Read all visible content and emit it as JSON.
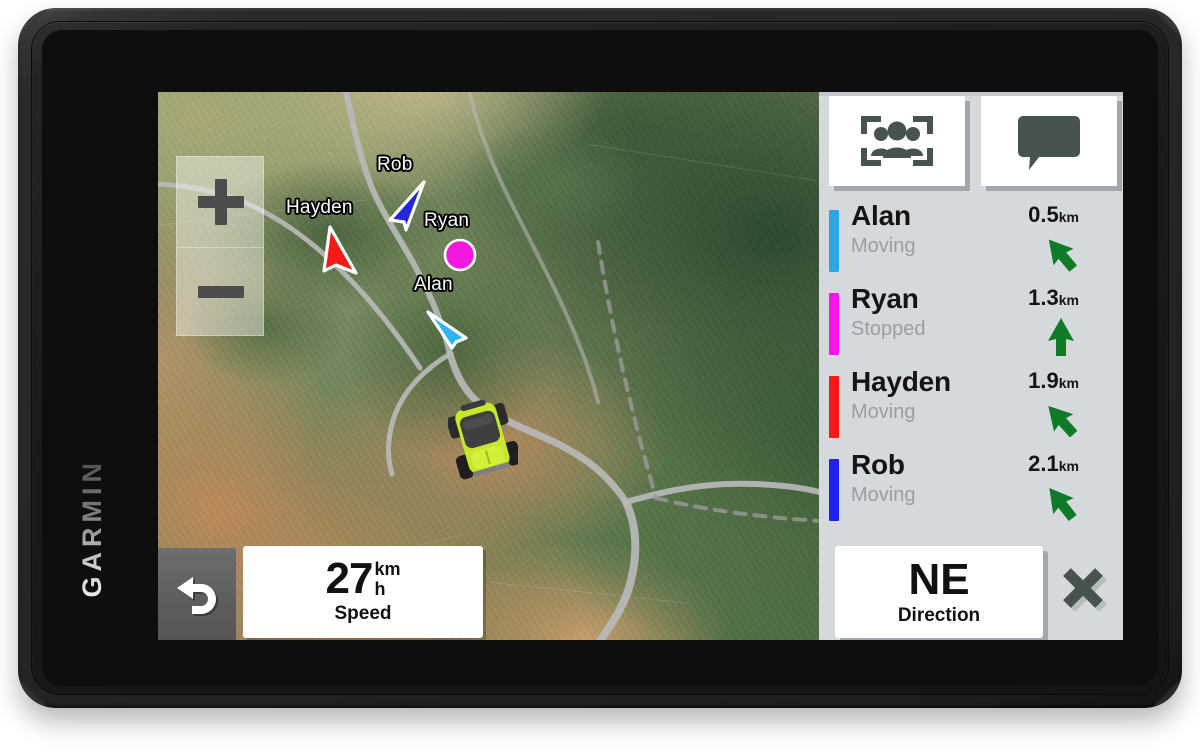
{
  "device": {
    "brand": "GARMIN"
  },
  "map": {
    "zoom_in_label": "+",
    "zoom_out_label": "−",
    "markers": [
      {
        "name": "Rob",
        "color": "#2228e0",
        "shape": "arrow"
      },
      {
        "name": "Hayden",
        "color": "#f21b16",
        "shape": "arrow"
      },
      {
        "name": "Ryan",
        "color": "#f218e0",
        "shape": "dot"
      },
      {
        "name": "Alan",
        "color": "#2fb4f5",
        "shape": "arrow"
      }
    ],
    "vehicle": {
      "name": "off-road-vehicle",
      "body_color": "#c8e62c",
      "cage_color": "#3c3c3c"
    }
  },
  "bottom_bar": {
    "back_icon": "back-arrow-icon",
    "speed": {
      "value": "27",
      "unit_top": "km",
      "unit_bottom": "h",
      "caption": "Speed"
    }
  },
  "sidebar": {
    "tiles": [
      {
        "icon": "group-track-icon",
        "label": "Group Track"
      },
      {
        "icon": "message-bubble-icon",
        "label": "Messages"
      }
    ],
    "members": [
      {
        "name": "Alan",
        "status": "Moving",
        "color": "#29a8e8",
        "distance": "0.5",
        "unit": "km",
        "bearing_deg": -40
      },
      {
        "name": "Ryan",
        "status": "Stopped",
        "color": "#f414f0",
        "distance": "1.3",
        "unit": "km",
        "bearing_deg": 0
      },
      {
        "name": "Hayden",
        "status": "Moving",
        "color": "#f51b12",
        "distance": "1.9",
        "unit": "km",
        "bearing_deg": -42
      },
      {
        "name": "Rob",
        "status": "Moving",
        "color": "#1c22e8",
        "distance": "2.1",
        "unit": "km",
        "bearing_deg": -38
      }
    ],
    "direction_card": {
      "value": "NE",
      "caption": "Direction"
    },
    "close_icon": "close-x-icon"
  },
  "colors": {
    "sidebar_bg": "#d6d9dc",
    "card_bg": "#ffffff",
    "icon_dark": "#465350",
    "status_text": "#9a9ea2",
    "arrow_green": "#0f7a28"
  }
}
